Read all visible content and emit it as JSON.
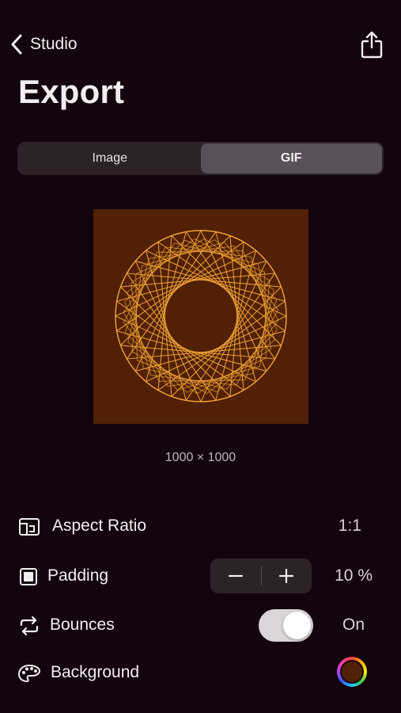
{
  "nav": {
    "back_label": "Studio"
  },
  "page_title": "Export",
  "segments": [
    {
      "label": "Image",
      "selected": false
    },
    {
      "label": "GIF",
      "selected": true
    }
  ],
  "preview": {
    "dimensions": "1000 × 1000",
    "background_color": "#512005",
    "stroke_color": "#f0a436"
  },
  "settings": {
    "aspect_ratio": {
      "label": "Aspect Ratio",
      "value": "1:1"
    },
    "padding": {
      "label": "Padding",
      "value": "10 %"
    },
    "bounces": {
      "label": "Bounces",
      "value": "On",
      "enabled": true
    },
    "background": {
      "label": "Background",
      "color": "#512005"
    }
  },
  "colors": {
    "page_bg": "#14040e",
    "control_bg": "#2e2229",
    "accent": "#f0a436"
  }
}
